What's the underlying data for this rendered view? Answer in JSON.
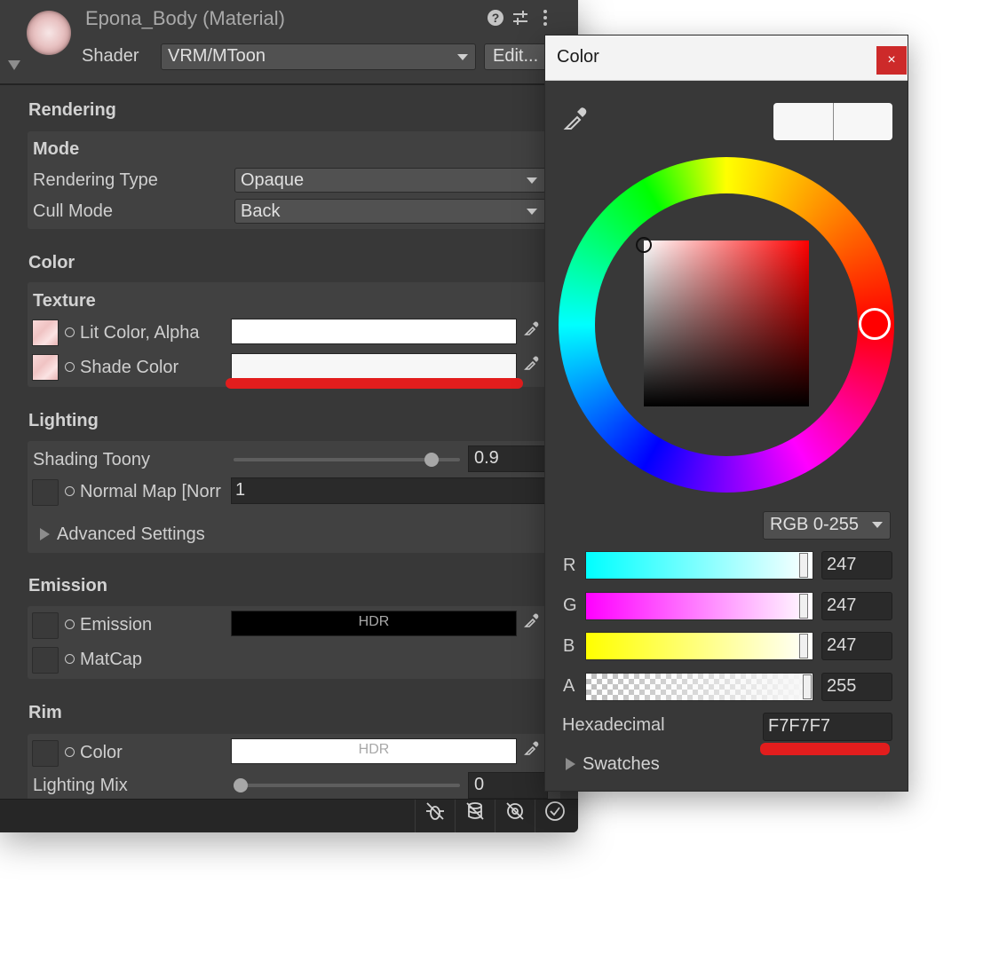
{
  "inspector": {
    "title": "Epona_Body (Material)",
    "shader_label": "Shader",
    "shader_value": "VRM/MToon",
    "edit_label": "Edit...",
    "rendering": {
      "title": "Rendering",
      "mode_title": "Mode",
      "rendering_type_label": "Rendering Type",
      "rendering_type_value": "Opaque",
      "cull_mode_label": "Cull Mode",
      "cull_mode_value": "Back"
    },
    "color": {
      "title": "Color",
      "texture_title": "Texture",
      "lit_color_label": "Lit Color, Alpha",
      "lit_color_value": "#ffffff",
      "shade_color_label": "Shade Color",
      "shade_color_value": "#f7f7f7"
    },
    "lighting": {
      "title": "Lighting",
      "shading_toony_label": "Shading Toony",
      "shading_toony_value": "0.9",
      "normal_map_label": "Normal Map [Norr",
      "normal_map_value": "1",
      "advanced_label": "Advanced Settings"
    },
    "emission": {
      "title": "Emission",
      "emission_label": "Emission",
      "emission_hdr": "HDR",
      "emission_color": "#000000",
      "matcap_label": "MatCap"
    },
    "rim": {
      "title": "Rim",
      "color_label": "Color",
      "color_hdr": "HDR",
      "color_value": "#ffffff",
      "lighting_mix_label": "Lighting Mix",
      "lighting_mix_value": "0"
    },
    "status_icons": [
      "debug-bug-icon",
      "database-icon",
      "hidden-eye-icon",
      "check-circle-icon"
    ]
  },
  "color_window": {
    "title": "Color",
    "close_label": "×",
    "mode_value": "RGB 0-255",
    "channels": [
      {
        "label": "R",
        "value": "247"
      },
      {
        "label": "G",
        "value": "247"
      },
      {
        "label": "B",
        "value": "247"
      },
      {
        "label": "A",
        "value": "255"
      }
    ],
    "hex_label": "Hexadecimal",
    "hex_value": "F7F7F7",
    "swatches_label": "Swatches",
    "current_color": "#f7f7f7",
    "hue_color": "#ff0000"
  },
  "annotation_color": "#e21d1d"
}
